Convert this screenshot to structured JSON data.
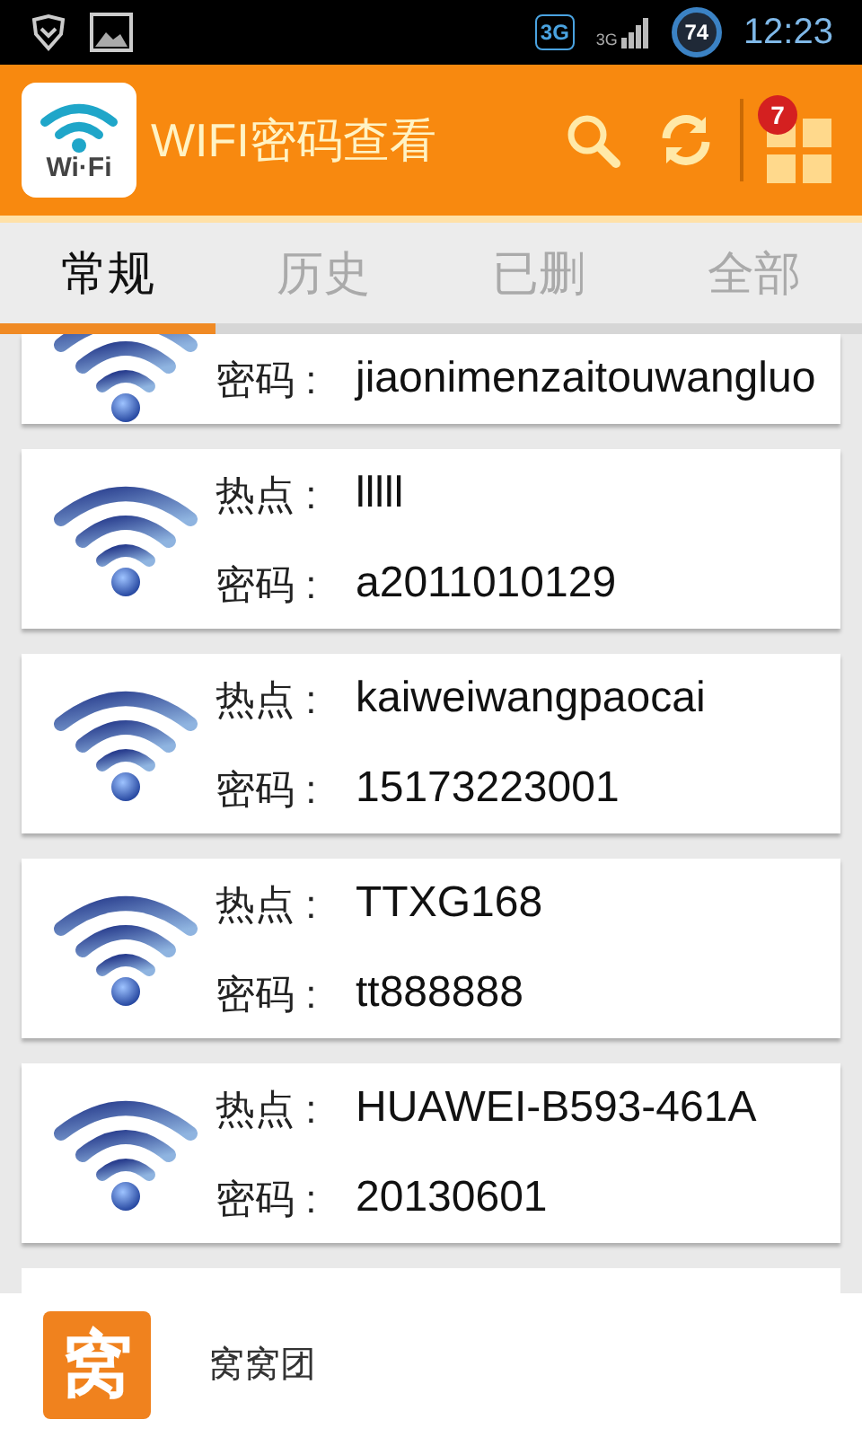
{
  "status_bar": {
    "network_badge": "3G",
    "signal_label": "3G",
    "battery": "74",
    "time": "12:23"
  },
  "app_bar": {
    "logo_text": "Wi·Fi",
    "title": "WIFI密码查看",
    "notification_count": "7"
  },
  "tabs": [
    {
      "label": "常规",
      "selected": true
    },
    {
      "label": "历史",
      "selected": false
    },
    {
      "label": "已删",
      "selected": false
    },
    {
      "label": "全部",
      "selected": false
    }
  ],
  "networks": [
    {
      "password_label": "密码 :",
      "password": "jiaonimenzaitouwangluo"
    },
    {
      "hotspot_label": "热点 :",
      "hotspot": "lllll",
      "password_label": "密码 :",
      "password": "a2011010129"
    },
    {
      "hotspot_label": "热点 :",
      "hotspot": "kaiweiwangpaocai",
      "password_label": "密码 :",
      "password": "15173223001"
    },
    {
      "hotspot_label": "热点 :",
      "hotspot": "TTXG168",
      "password_label": "密码 :",
      "password": "tt888888"
    },
    {
      "hotspot_label": "热点 :",
      "hotspot": "HUAWEI-B593-461A",
      "password_label": "密码 :",
      "password": "20130601"
    }
  ],
  "ad_banner": {
    "logo_text": "窝",
    "name": "窝窝团"
  }
}
